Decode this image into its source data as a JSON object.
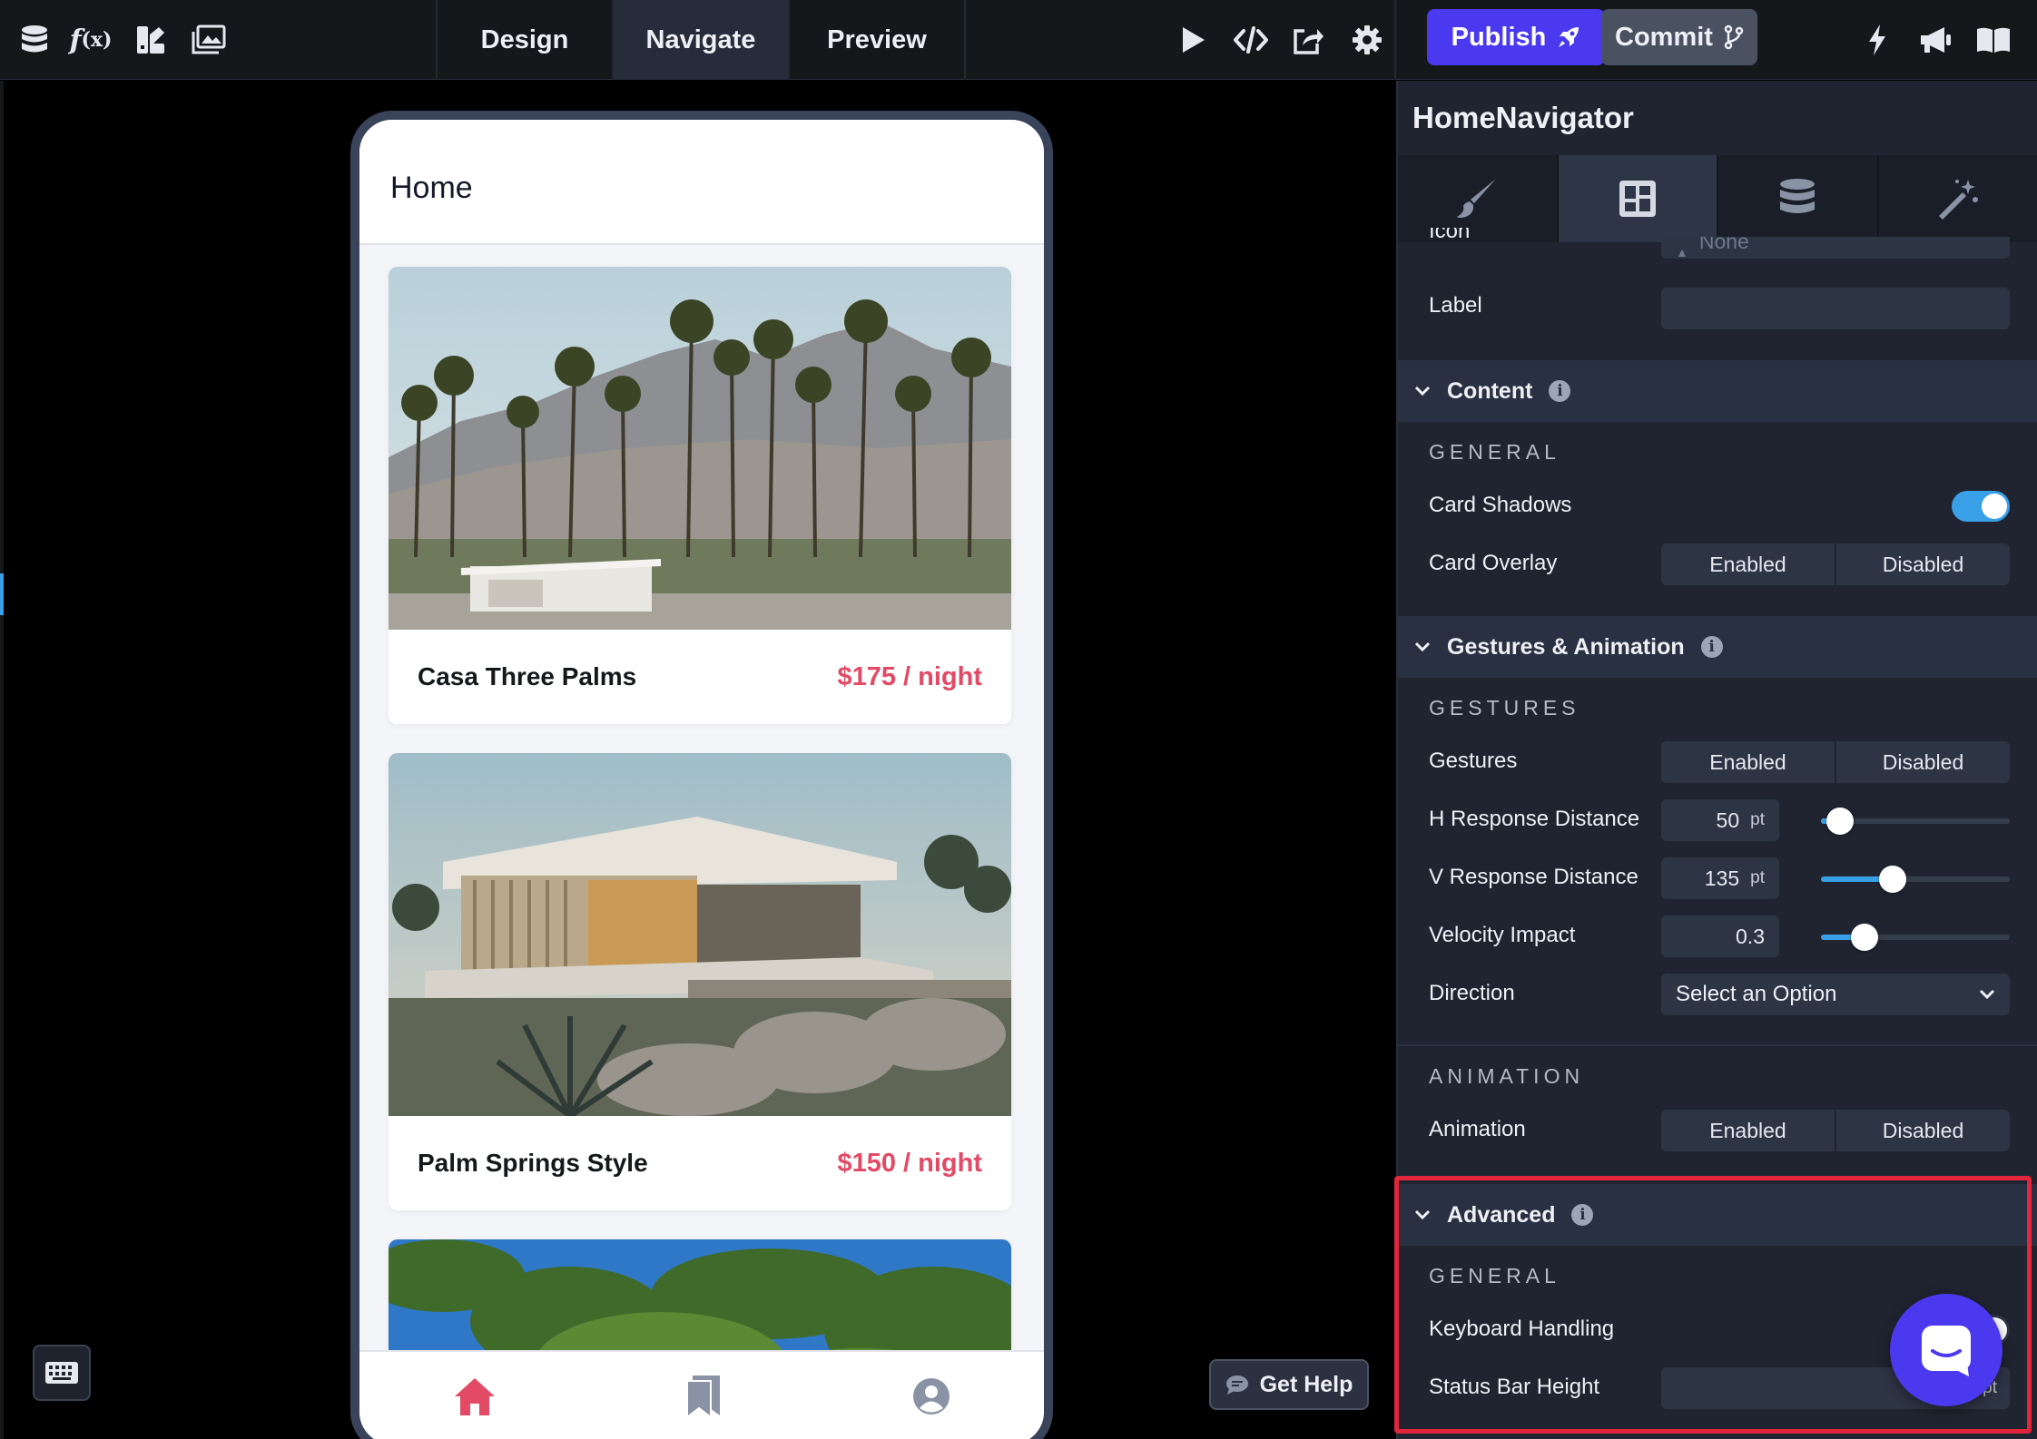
{
  "toolbar": {
    "left_icons": [
      "database-icon",
      "function-icon",
      "theme-icon",
      "media-icon"
    ],
    "tabs": [
      {
        "label": "Design",
        "active": false
      },
      {
        "label": "Navigate",
        "active": true
      },
      {
        "label": "Preview",
        "active": false
      }
    ],
    "right_icons": [
      "play-icon",
      "code-icon",
      "share-icon",
      "gear-icon"
    ],
    "publish_label": "Publish",
    "commit_label": "Commit",
    "far_right_icons": [
      "bolt-icon",
      "megaphone-icon",
      "book-icon"
    ]
  },
  "preview": {
    "screen_title": "Home",
    "cards": [
      {
        "name": "Casa Three Palms",
        "price": "$175 / night"
      },
      {
        "name": "Palm Springs Style",
        "price": "$150 / night"
      }
    ],
    "nav_icons": [
      "home-icon",
      "bookmark-icon",
      "profile-icon"
    ]
  },
  "get_help_label": "Get Help",
  "panel": {
    "title": "HomeNavigator",
    "tabs": [
      "brush-icon",
      "layout-icon",
      "database-icon",
      "magic-wand-icon"
    ],
    "icon_row": {
      "label": "Icon",
      "value": "None"
    },
    "label_row": {
      "label": "Label",
      "value": ""
    },
    "content": {
      "title": "Content",
      "general_caption": "GENERAL",
      "card_shadows_label": "Card Shadows",
      "card_shadows_on": true,
      "card_overlay_label": "Card Overlay",
      "card_overlay_options": [
        "Enabled",
        "Disabled"
      ]
    },
    "gestures": {
      "title": "Gestures & Animation",
      "gestures_caption": "GESTURES",
      "gestures_label": "Gestures",
      "gestures_options": [
        "Enabled",
        "Disabled"
      ],
      "h_label": "H Response Distance",
      "h_value": "50",
      "h_unit": "pt",
      "h_fraction": 0.1,
      "v_label": "V Response Distance",
      "v_value": "135",
      "v_unit": "pt",
      "v_fraction": 0.38,
      "velocity_label": "Velocity Impact",
      "velocity_value": "0.3",
      "velocity_fraction": 0.23,
      "direction_label": "Direction",
      "direction_value": "Select an Option",
      "animation_caption": "ANIMATION",
      "animation_label": "Animation",
      "animation_options": [
        "Enabled",
        "Disabled"
      ]
    },
    "advanced": {
      "title": "Advanced",
      "general_caption": "GENERAL",
      "keyboard_label": "Keyboard Handling",
      "status_bar_label": "Status Bar Height",
      "status_bar_unit": "pt"
    }
  },
  "colors": {
    "accent": "#4b39ef",
    "toggle_blue": "#39a0e8",
    "price_red": "#e24a66",
    "highlight_red": "#e1253b"
  }
}
